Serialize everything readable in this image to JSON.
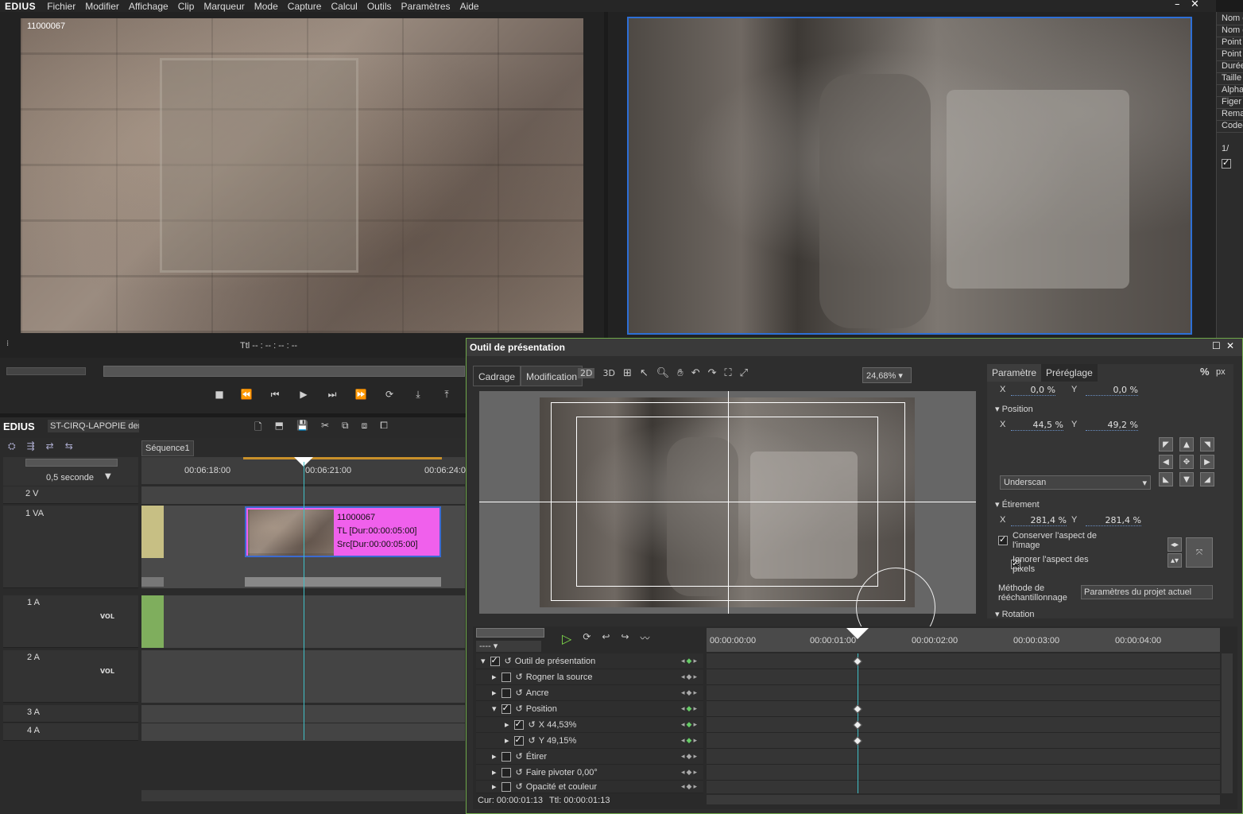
{
  "app": {
    "logo": "EDIUS"
  },
  "menu": [
    "Fichier",
    "Modifier",
    "Affichage",
    "Clip",
    "Marqueur",
    "Mode",
    "Capture",
    "Calcul",
    "Outils",
    "Paramètres",
    "Aide"
  ],
  "player": {
    "clip_id": "11000067",
    "ttl": "Ttl -- : -- : -- : --"
  },
  "timeline": {
    "project": "ST-CIRQ-LAPOPIE der",
    "sequence": "Séquence1",
    "zoom": "0,5 seconde",
    "ticks": [
      "00:06:18:00",
      "00:06:21:00",
      "00:06:24:0"
    ],
    "tracks": [
      "2 V",
      "1 VA",
      "1 A",
      "2 A",
      "3 A",
      "4 A"
    ],
    "vol": "VOL",
    "clip": {
      "name": "11000067",
      "tl": "TL [Dur:00:00:05:00]",
      "src": "Src[Dur:00:00:05:00]"
    }
  },
  "dialog": {
    "title": "Outil de présentation",
    "tabs": [
      "Cadrage",
      "Modification"
    ],
    "zoom": "24,68%",
    "param_tabs": [
      "Paramètre",
      "Préréglage"
    ],
    "units": [
      "%",
      "px"
    ],
    "top_x": "0,0 %",
    "top_y": "0,0 %",
    "position_label": "Position",
    "pos_x": "44,5 %",
    "pos_y": "49,2 %",
    "scan": "Underscan",
    "stretch_label": "Étirement",
    "str_x": "281,4 %",
    "str_y": "281,4 %",
    "keep_aspect": "Conserver l'aspect de l'image",
    "ignore_aspect": "Ignorer l'aspect des pixels",
    "resample_label": "Méthode de rééchantillonnage",
    "resample_value": "Paramètres du projet actuel",
    "rotation_label": "Rotation",
    "x_label": "X",
    "y_label": "Y",
    "kf_ticks": [
      "00:00:00:00",
      "00:00:01:00",
      "00:00:02:00",
      "00:00:03:00",
      "00:00:04:00"
    ],
    "kf_rows": [
      {
        "label": "Outil de présentation"
      },
      {
        "label": "Rogner la source"
      },
      {
        "label": "Ancre"
      },
      {
        "label": "Position"
      },
      {
        "label": "X    44,53%"
      },
      {
        "label": "Y    49,15%"
      },
      {
        "label": "Étirer"
      },
      {
        "label": "Faire pivoter    0,00°"
      },
      {
        "label": "Opacité et couleur"
      }
    ],
    "cur": "Cur: 00:00:01:13",
    "ttl": "Ttl: 00:00:01:13",
    "frame_select": "----"
  },
  "right_panel": [
    "Nom c",
    "Nom d",
    "Point",
    "Point",
    "Durée",
    "Taille",
    "Alpha",
    "Figer",
    "Rema",
    "Codec"
  ],
  "right_extra": "1/"
}
